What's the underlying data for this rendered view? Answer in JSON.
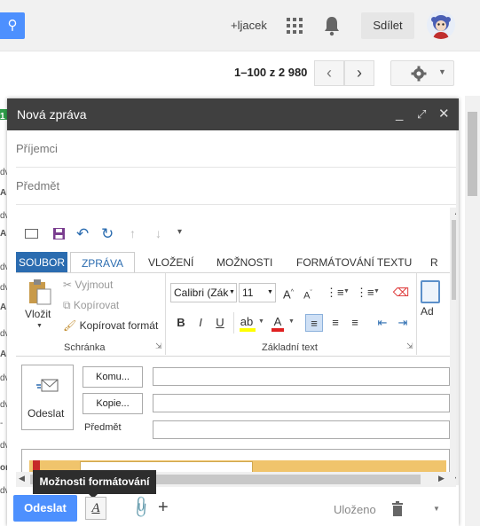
{
  "header": {
    "plus_user": "+ljacek",
    "share_label": "Sdílet"
  },
  "toolbar": {
    "pager_text": "1–100 z 2 980"
  },
  "left_strip": [
    "1",
    "dv",
    "A",
    "dv",
    "A",
    "dv",
    "dv",
    "A",
    "dv",
    "A",
    "dv",
    "dv",
    "-",
    "dv",
    "or",
    "dv"
  ],
  "compose": {
    "title": "Nová zpráva",
    "to_placeholder": "Příjemci",
    "subject_placeholder": "Předmět",
    "ribbon": {
      "tabs": [
        "SOUBOR",
        "ZPRÁVA",
        "VLOŽENÍ",
        "MOŽNOSTI",
        "FORMÁTOVÁNÍ TEXTU",
        "R"
      ],
      "paste_label": "Vložit",
      "cut_label": "Vyjmout",
      "copy_label": "Kopírovat",
      "format_painter_label": "Kopírovat formát",
      "clipboard_group": "Schránka",
      "font_name": "Calibri (Zák",
      "font_size": "11",
      "basic_text_group": "Základní text",
      "address_label": "Ad"
    },
    "mail_header": {
      "send_label": "Odeslat",
      "to_button": "Komu...",
      "cc_button": "Kopie...",
      "subject_label": "Předmět"
    },
    "tooltip": "Možnosti formátování",
    "send_label": "Odeslat",
    "format_icon_glyph": "A",
    "saved_label": "Uloženo"
  }
}
